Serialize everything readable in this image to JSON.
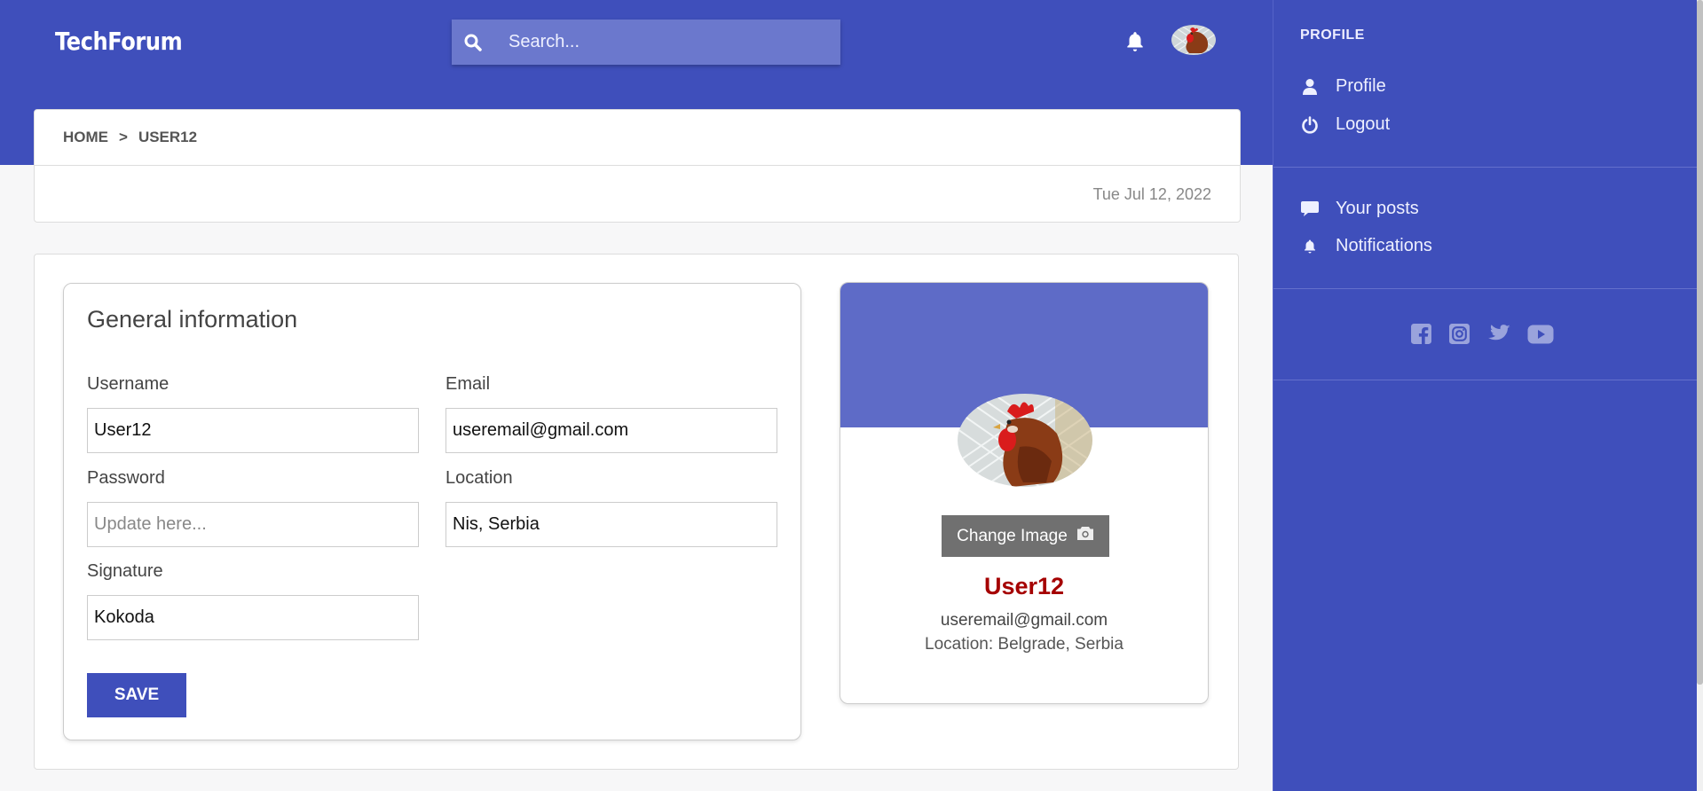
{
  "header": {
    "logo": "TechForum",
    "search_placeholder": "Search..."
  },
  "breadcrumb": {
    "home": "HOME",
    "separator": ">",
    "current": "USER12"
  },
  "date": "Tue Jul 12, 2022",
  "form": {
    "title": "General information",
    "username_label": "Username",
    "username_value": "User12",
    "email_label": "Email",
    "email_value": "useremail@gmail.com",
    "password_label": "Password",
    "password_placeholder": "Update here...",
    "location_label": "Location",
    "location_value": "Nis, Serbia",
    "signature_label": "Signature",
    "signature_value": "Kokoda",
    "save_label": "SAVE"
  },
  "profile_card": {
    "change_image_label": "Change Image",
    "name": "User12",
    "email": "useremail@gmail.com",
    "location": "Location: Belgrade, Serbia"
  },
  "sidebar": {
    "heading": "PROFILE",
    "items": [
      {
        "label": "Profile",
        "icon": "user-icon"
      },
      {
        "label": "Logout",
        "icon": "power-icon"
      },
      {
        "label": "Your posts",
        "icon": "comment-icon"
      },
      {
        "label": "Notifications",
        "icon": "bell-icon"
      }
    ],
    "socials": [
      "facebook-icon",
      "instagram-icon",
      "twitter-icon",
      "youtube-icon"
    ]
  },
  "colors": {
    "primary": "#3f4fbb",
    "banner": "#5e6bc7",
    "name_red": "#a50000"
  }
}
